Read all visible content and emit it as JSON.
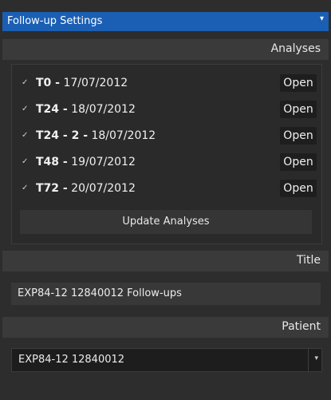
{
  "panel": {
    "title": "Follow-up Settings",
    "title_caret": "▾"
  },
  "analyses": {
    "header": "Analyses",
    "items": [
      {
        "code": "T0 -",
        "date": "17/07/2012",
        "open_label": "Open",
        "checked": true
      },
      {
        "code": "T24 -",
        "date": "18/07/2012",
        "open_label": "Open",
        "checked": true
      },
      {
        "code": "T24 - 2 -",
        "date": "18/07/2012",
        "open_label": "Open",
        "checked": true
      },
      {
        "code": "T48 -",
        "date": "19/07/2012",
        "open_label": "Open",
        "checked": true
      },
      {
        "code": "T72 -",
        "date": "20/07/2012",
        "open_label": "Open",
        "checked": true
      }
    ],
    "update_label": "Update Analyses"
  },
  "title_section": {
    "header": "Title",
    "value": "EXP84-12 12840012 Follow-ups"
  },
  "patient_section": {
    "header": "Patient",
    "selected": "EXP84-12 12840012",
    "caret": "▾"
  },
  "colors": {
    "accent": "#1a5fb4",
    "panel_bg": "#2d2d2d",
    "header_bg": "#3a3a3a"
  }
}
